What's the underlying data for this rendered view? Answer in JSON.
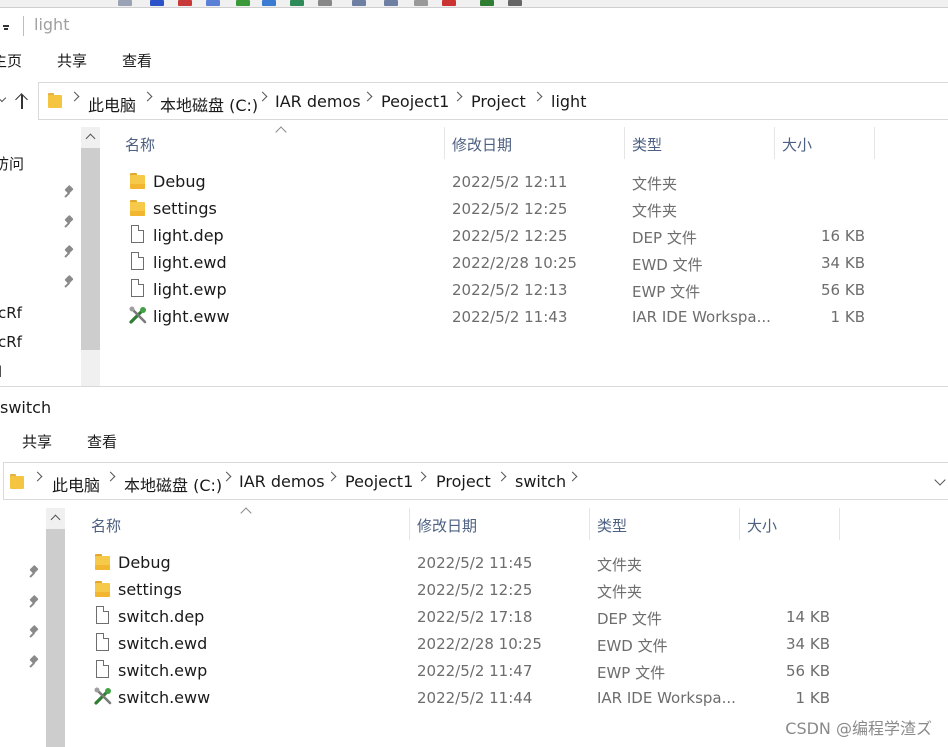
{
  "top_window": {
    "title": "light",
    "ribbon_tabs": [
      "主页",
      "共享",
      "查看"
    ],
    "breadcrumb": [
      "此电脑",
      "本地磁盘 (C:)",
      "IAR demos",
      "Peoject1",
      "Project",
      "light"
    ],
    "nav_labels": [
      "访问",
      "cRf",
      "cRf",
      "l"
    ],
    "columns": [
      "名称",
      "修改日期",
      "类型",
      "大小"
    ],
    "files": [
      {
        "name": "Debug",
        "icon": "folder-icon",
        "date": "2022/5/2 12:11",
        "type": "文件夹",
        "size": ""
      },
      {
        "name": "settings",
        "icon": "folder-icon",
        "date": "2022/5/2 12:25",
        "type": "文件夹",
        "size": ""
      },
      {
        "name": "light.dep",
        "icon": "file-icon",
        "date": "2022/5/2 12:25",
        "type": "DEP 文件",
        "size": "16 KB"
      },
      {
        "name": "light.ewd",
        "icon": "file-icon",
        "date": "2022/2/28 10:25",
        "type": "EWD 文件",
        "size": "34 KB"
      },
      {
        "name": "light.ewp",
        "icon": "file-icon",
        "date": "2022/5/2 12:13",
        "type": "EWP 文件",
        "size": "56 KB"
      },
      {
        "name": "light.eww",
        "icon": "iar-workspace-icon",
        "date": "2022/5/2 11:43",
        "type": "IAR IDE Workspa...",
        "size": "1 KB"
      }
    ]
  },
  "bottom_window": {
    "title": "switch",
    "ribbon_tabs": [
      "共享",
      "查看"
    ],
    "breadcrumb": [
      "此电脑",
      "本地磁盘 (C:)",
      "IAR demos",
      "Peoject1",
      "Project",
      "switch"
    ],
    "columns": [
      "名称",
      "修改日期",
      "类型",
      "大小"
    ],
    "files": [
      {
        "name": "Debug",
        "icon": "folder-icon",
        "date": "2022/5/2 11:45",
        "type": "文件夹",
        "size": ""
      },
      {
        "name": "settings",
        "icon": "folder-icon",
        "date": "2022/5/2 12:25",
        "type": "文件夹",
        "size": ""
      },
      {
        "name": "switch.dep",
        "icon": "file-icon",
        "date": "2022/5/2 17:18",
        "type": "DEP 文件",
        "size": "14 KB"
      },
      {
        "name": "switch.ewd",
        "icon": "file-icon",
        "date": "2022/2/28 10:25",
        "type": "EWD 文件",
        "size": "34 KB"
      },
      {
        "name": "switch.ewp",
        "icon": "file-icon",
        "date": "2022/5/2 11:47",
        "type": "EWP 文件",
        "size": "56 KB"
      },
      {
        "name": "switch.eww",
        "icon": "iar-workspace-icon",
        "date": "2022/5/2 11:44",
        "type": "IAR IDE Workspa...",
        "size": "1 KB"
      }
    ]
  },
  "watermark": "CSDN @编程学渣ズ"
}
